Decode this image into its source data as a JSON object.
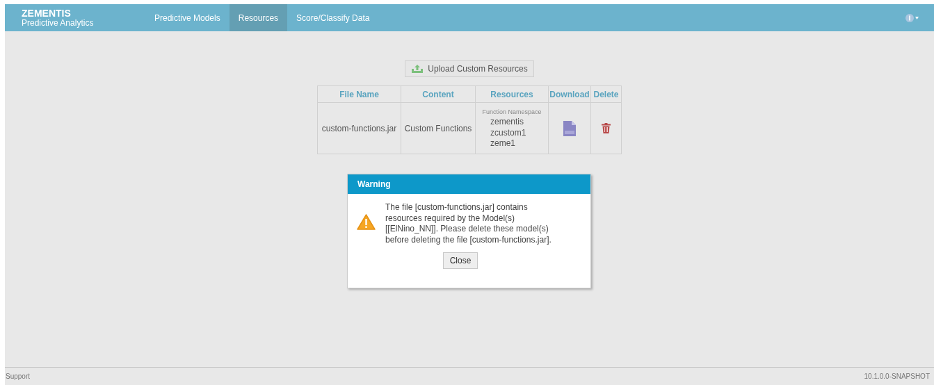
{
  "brand": {
    "title": "ZEMENTIS",
    "subtitle": "Predictive Analytics"
  },
  "nav": [
    {
      "label": "Predictive Models",
      "selected": false
    },
    {
      "label": "Resources",
      "selected": true
    },
    {
      "label": "Score/Classify Data",
      "selected": false
    }
  ],
  "upload_button": "Upload Custom Resources",
  "table": {
    "columns": [
      "File Name",
      "Content",
      "Resources",
      "Download",
      "Delete"
    ],
    "rows": [
      {
        "file_name": "custom-functions.jar",
        "content": "Custom Functions",
        "resources_label": "Function Namespace",
        "resources": [
          "zementis",
          "zcustom1",
          "zeme1"
        ]
      }
    ]
  },
  "dialog": {
    "title": "Warning",
    "message": "The file [custom-functions.jar] contains resources required by the Model(s) [[ElNino_NN]]. Please delete these model(s) before deleting the file [custom-functions.jar].",
    "button": "Close"
  },
  "footer": {
    "left": "Support",
    "right": "10.1.0.0-SNAPSHOT"
  }
}
